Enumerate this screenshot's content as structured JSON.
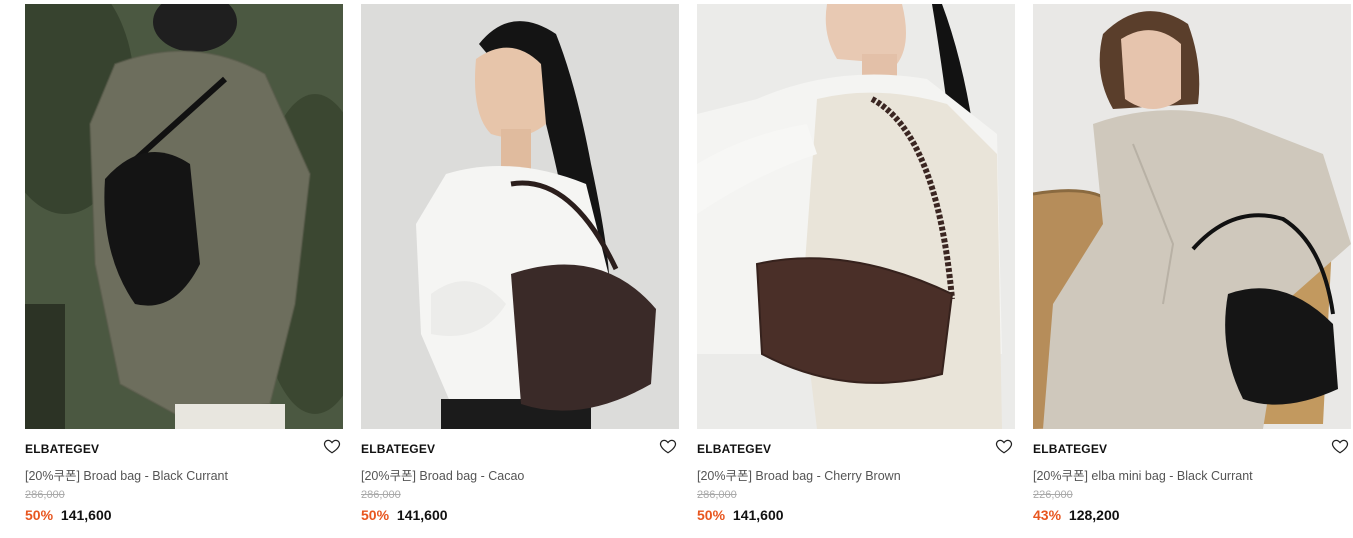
{
  "products": [
    {
      "brand": "ELBATEGEV",
      "name": "[20%쿠폰] Broad bag - Black Currant",
      "original_price": "286,000",
      "discount": "50%",
      "price": "141,600",
      "wishlist_icon": "heart-outline-icon"
    },
    {
      "brand": "ELBATEGEV",
      "name": "[20%쿠폰] Broad bag - Cacao",
      "original_price": "286,000",
      "discount": "50%",
      "price": "141,600",
      "wishlist_icon": "heart-outline-icon"
    },
    {
      "brand": "ELBATEGEV",
      "name": "[20%쿠폰] Broad bag - Cherry Brown",
      "original_price": "286,000",
      "discount": "50%",
      "price": "141,600",
      "wishlist_icon": "heart-outline-icon"
    },
    {
      "brand": "ELBATEGEV",
      "name": "[20%쿠폰] elba mini bag - Black Currant",
      "original_price": "226,000",
      "discount": "43%",
      "price": "128,200",
      "wishlist_icon": "heart-outline-icon"
    }
  ],
  "colors": {
    "discount": "#e8561f",
    "brand_text": "#111111",
    "name_text": "#555555",
    "original_price_text": "#aaaaaa"
  }
}
